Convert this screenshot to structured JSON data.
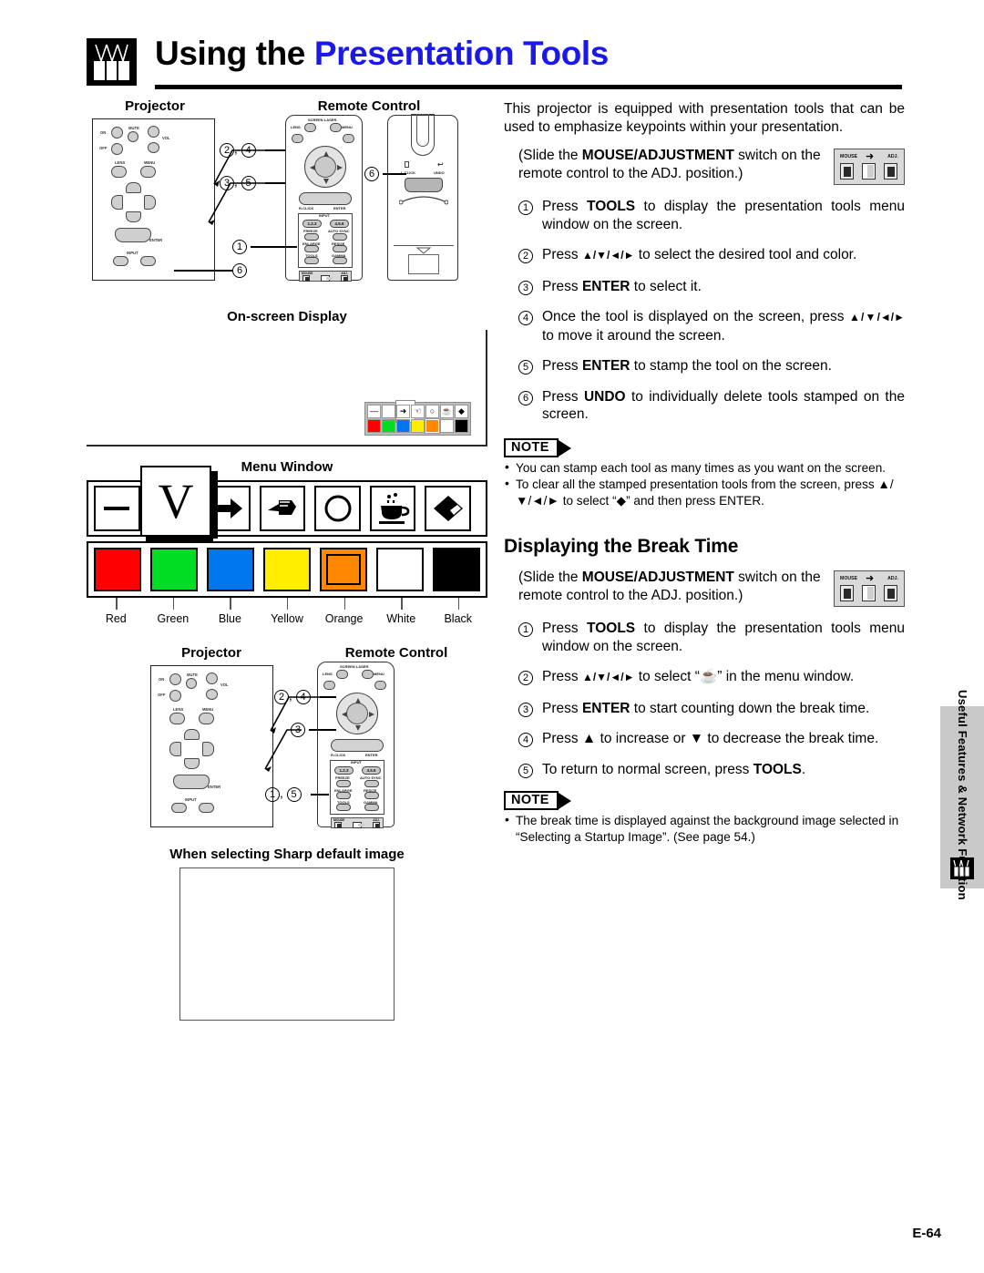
{
  "page": {
    "title_plain": "Using the ",
    "title_accent": "Presentation Tools",
    "page_number": "E-64",
    "logo_name": "sharp-projector-logo"
  },
  "side_tab": {
    "label": "Useful Features &\nNetwork Function"
  },
  "diagram_top": {
    "label_projector": "Projector",
    "label_remote": "Remote Control",
    "callouts": [
      "2, 4",
      "3, 5",
      "1",
      "6",
      "6"
    ]
  },
  "osd": {
    "caption": "On-screen Display",
    "tools": [
      "—",
      "V",
      "➜",
      "✍",
      "○",
      "☕",
      "◆"
    ],
    "colors": [
      "#ff0000",
      "#00dd22",
      "#0077ee",
      "#ffee00",
      "#ff8800",
      "#ffffff",
      "#000000"
    ],
    "selected_tool_index": 1,
    "selected_color_index": 4
  },
  "menu_window": {
    "caption": "Menu Window",
    "tools": [
      {
        "name": "line-tool",
        "glyph": "—"
      },
      {
        "name": "check-tool",
        "glyph": "V"
      },
      {
        "name": "arrow-tool",
        "glyph": "➜"
      },
      {
        "name": "pointing-hand-tool",
        "glyph": "☚"
      },
      {
        "name": "circle-tool",
        "glyph": "◯"
      },
      {
        "name": "break-time-tool",
        "glyph": "☕"
      },
      {
        "name": "eraser-tool",
        "glyph": "◆"
      }
    ],
    "selected_tool_index": 1,
    "colors": [
      {
        "label": "Red",
        "hex": "#ff0000"
      },
      {
        "label": "Green",
        "hex": "#00dd22"
      },
      {
        "label": "Blue",
        "hex": "#0077ee"
      },
      {
        "label": "Yellow",
        "hex": "#ffee00"
      },
      {
        "label": "Orange",
        "hex": "#ff8800"
      },
      {
        "label": "White",
        "hex": "#ffffff"
      },
      {
        "label": "Black",
        "hex": "#000000"
      }
    ],
    "selected_color_index": 4
  },
  "diagram_bottom": {
    "label_projector": "Projector",
    "label_remote": "Remote Control",
    "callouts": [
      "2, 4",
      "3",
      "1, 5"
    ],
    "caption": "When selecting Sharp default image"
  },
  "intro": {
    "paragraph": "This projector is equipped with presentation tools that can be used to emphasize keypoints within your presentation."
  },
  "switch_note": {
    "prefix": "(Slide the ",
    "bold": "MOUSE/ADJUSTMENT",
    "suffix": " switch on the remote control to the ADJ. position.)",
    "graphic": {
      "mouse_label": "MOUSE",
      "adj_label": "ADJ.",
      "arrow": "➜"
    }
  },
  "steps_tools": [
    {
      "num": "1",
      "pre": "Press ",
      "bold": "TOOLS",
      "post": " to display the presentation tools menu window on the screen."
    },
    {
      "num": "2",
      "pre": "Press ",
      "bold": "▲/▼/◄/►",
      "post": " to select the desired tool and color.",
      "bold_is_arrows": true
    },
    {
      "num": "3",
      "pre": "Press ",
      "bold": "ENTER",
      "post": " to select it."
    },
    {
      "num": "4",
      "pre": "Once the tool is displayed on the screen, press ",
      "bold": "▲/▼/◄/►",
      "post": " to move it around the screen.",
      "bold_is_arrows": true
    },
    {
      "num": "5",
      "pre": "Press ",
      "bold": "ENTER",
      "post": " to stamp the tool on the screen."
    },
    {
      "num": "6",
      "pre": "Press ",
      "bold": "UNDO",
      "post": " to individually delete tools stamped on the screen."
    }
  ],
  "note_tools": {
    "label": "NOTE",
    "items": [
      "You can stamp each tool as many times as you want on the screen.",
      "To clear all the stamped presentation tools from the screen, press ▲/▼/◄/► to select “◆” and then press ENTER."
    ]
  },
  "break_time": {
    "heading": "Displaying the Break Time",
    "steps": [
      {
        "num": "1",
        "pre": "Press ",
        "bold": "TOOLS",
        "post": " to display the presentation tools menu window on the screen."
      },
      {
        "num": "2",
        "pre": "Press ",
        "bold": "▲/▼/◄/►",
        "post": " to select “☕” in the menu window.",
        "bold_is_arrows": true
      },
      {
        "num": "3",
        "pre": "Press ",
        "bold": "ENTER",
        "post": " to start counting down the break time."
      },
      {
        "num": "4",
        "pre": "Press ▲ to increase or ▼ to decrease the break time.",
        "bold": "",
        "post": ""
      },
      {
        "num": "5",
        "pre": "To return to normal screen, press ",
        "bold": "TOOLS",
        "post": "."
      }
    ],
    "note": {
      "label": "NOTE",
      "items": [
        "The break time is displayed against the background image selected in “Selecting a Startup Image”. (See page 54.)"
      ]
    }
  }
}
